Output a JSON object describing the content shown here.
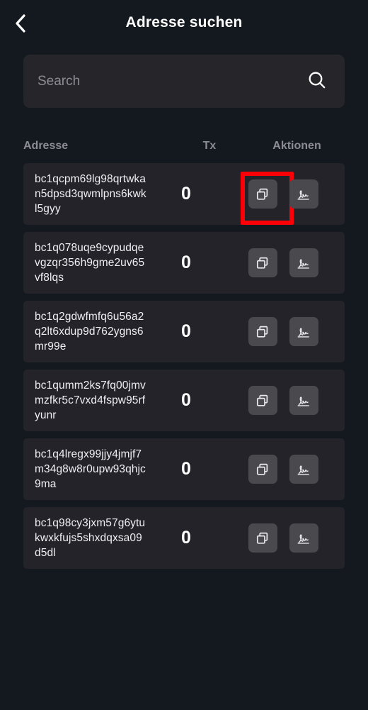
{
  "header": {
    "title": "Adresse suchen",
    "back_icon": "chevron-left-icon"
  },
  "search": {
    "placeholder": "Search",
    "value": "",
    "icon": "search-icon"
  },
  "table": {
    "columns": {
      "address": "Adresse",
      "tx": "Tx",
      "actions": "Aktionen"
    },
    "actions": {
      "copy_icon": "copy-icon",
      "sign_icon": "signature-icon"
    },
    "rows": [
      {
        "address": "bc1qcpm69lg98qrtwkan5dpsd3qwmlpns6kwkl5gyy",
        "tx": "0",
        "copy_highlighted": true
      },
      {
        "address": "bc1q078uqe9cypudqevgzqr356h9gme2uv65vf8lqs",
        "tx": "0",
        "copy_highlighted": false
      },
      {
        "address": "bc1q2gdwfmfq6u56a2q2lt6xdup9d762ygns6mr99e",
        "tx": "0",
        "copy_highlighted": false
      },
      {
        "address": "bc1qumm2ks7fq00jmvmzfkr5c7vxd4fspw95rfyunr",
        "tx": "0",
        "copy_highlighted": false
      },
      {
        "address": "bc1q4lregx99jjy4jmjf7m34g8w8r0upw93qhjc9ma",
        "tx": "0",
        "copy_highlighted": false
      },
      {
        "address": "bc1q98cy3jxm57g6ytukwxkfujs5shxdqxsa09d5dl",
        "tx": "0",
        "copy_highlighted": false
      }
    ]
  },
  "colors": {
    "page_background": "#141920",
    "card_background": "#232329",
    "search_background": "#26262a",
    "action_button": "#4a4a4e",
    "muted_text": "#8c8c92",
    "highlight": "#fb0007"
  }
}
